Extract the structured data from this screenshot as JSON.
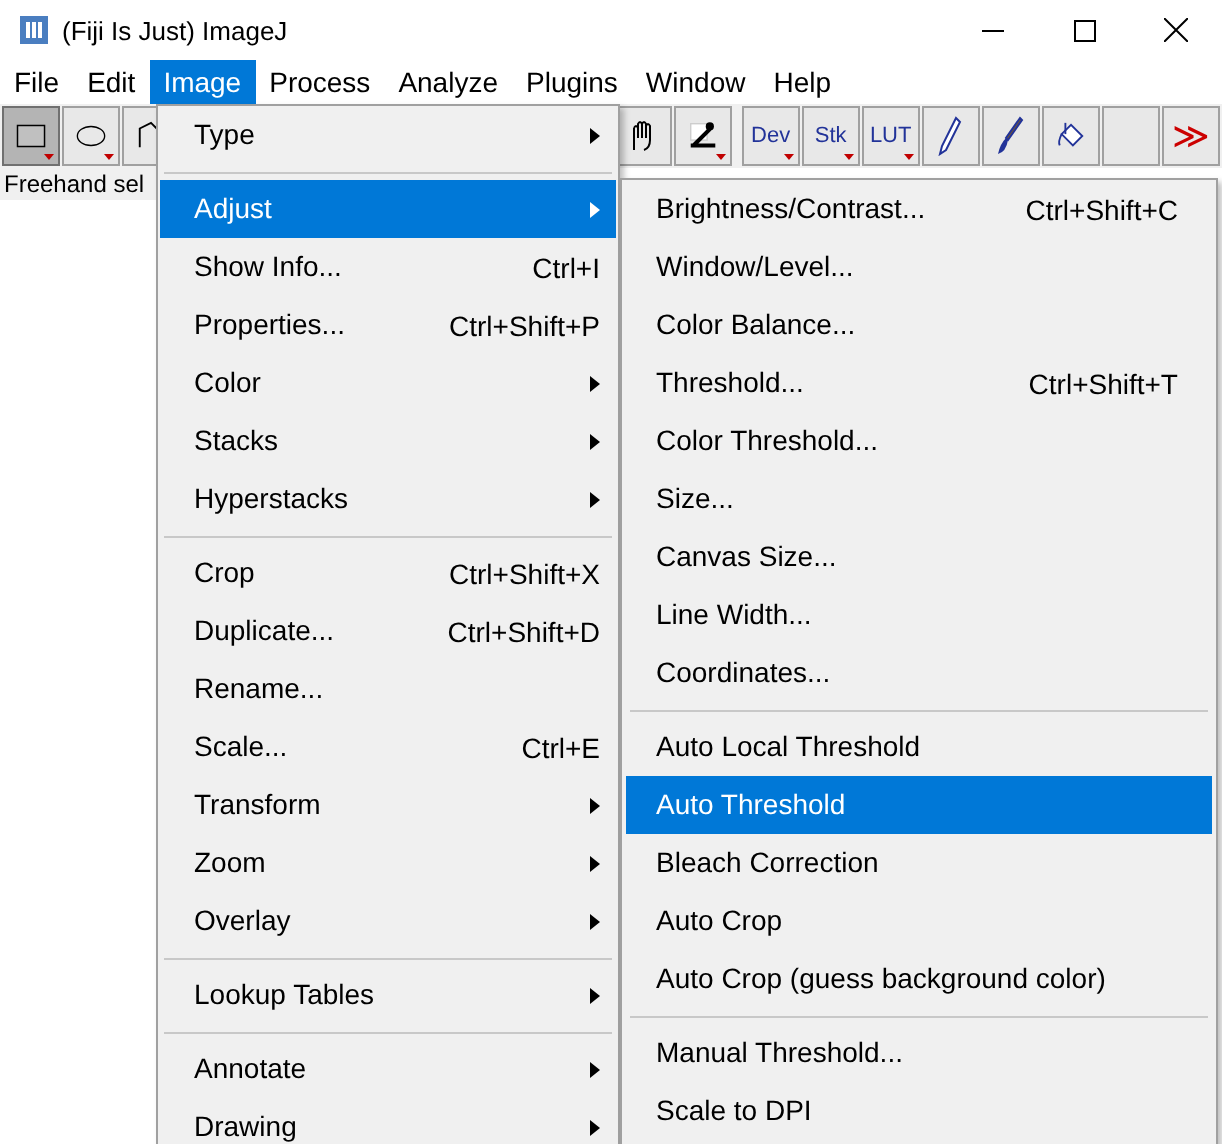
{
  "window": {
    "title": "(Fiji Is Just) ImageJ"
  },
  "menubar": [
    {
      "label": "File",
      "selected": false
    },
    {
      "label": "Edit",
      "selected": false
    },
    {
      "label": "Image",
      "selected": true
    },
    {
      "label": "Process",
      "selected": false
    },
    {
      "label": "Analyze",
      "selected": false
    },
    {
      "label": "Plugins",
      "selected": false
    },
    {
      "label": "Window",
      "selected": false
    },
    {
      "label": "Help",
      "selected": false
    }
  ],
  "toolbar_left": [
    {
      "kind": "rectangle",
      "pressed": true
    },
    {
      "kind": "oval",
      "pressed": false
    },
    {
      "kind": "polygon",
      "pressed": false
    }
  ],
  "toolbar_right": [
    {
      "kind": "hand",
      "pressed": false
    },
    {
      "kind": "angle",
      "pressed": false
    },
    {
      "kind": "gap"
    },
    {
      "kind": "text",
      "label": "Dev",
      "pressed": false
    },
    {
      "kind": "text",
      "label": "Stk",
      "pressed": false
    },
    {
      "kind": "text",
      "label": "LUT",
      "pressed": false
    },
    {
      "kind": "pencil",
      "pressed": false
    },
    {
      "kind": "brush",
      "pressed": false
    },
    {
      "kind": "fill",
      "pressed": false
    },
    {
      "kind": "blank",
      "pressed": false
    },
    {
      "kind": "more",
      "label": "≫",
      "pressed": false
    }
  ],
  "status_bar": {
    "text": "Freehand sel"
  },
  "image_menu": [
    {
      "kind": "item",
      "label": "Type",
      "submenu": true,
      "selected": false
    },
    {
      "kind": "separator"
    },
    {
      "kind": "item",
      "label": "Adjust",
      "submenu": true,
      "selected": true
    },
    {
      "kind": "item",
      "label": "Show Info...",
      "shortcut": "Ctrl+I",
      "selected": false
    },
    {
      "kind": "item",
      "label": "Properties...",
      "shortcut": "Ctrl+Shift+P",
      "selected": false
    },
    {
      "kind": "item",
      "label": "Color",
      "submenu": true,
      "selected": false
    },
    {
      "kind": "item",
      "label": "Stacks",
      "submenu": true,
      "selected": false
    },
    {
      "kind": "item",
      "label": "Hyperstacks",
      "submenu": true,
      "selected": false
    },
    {
      "kind": "separator"
    },
    {
      "kind": "item",
      "label": "Crop",
      "shortcut": "Ctrl+Shift+X",
      "selected": false
    },
    {
      "kind": "item",
      "label": "Duplicate...",
      "shortcut": "Ctrl+Shift+D",
      "selected": false
    },
    {
      "kind": "item",
      "label": "Rename...",
      "selected": false
    },
    {
      "kind": "item",
      "label": "Scale...",
      "shortcut": "Ctrl+E",
      "selected": false
    },
    {
      "kind": "item",
      "label": "Transform",
      "submenu": true,
      "selected": false
    },
    {
      "kind": "item",
      "label": "Zoom",
      "submenu": true,
      "selected": false
    },
    {
      "kind": "item",
      "label": "Overlay",
      "submenu": true,
      "selected": false
    },
    {
      "kind": "separator"
    },
    {
      "kind": "item",
      "label": "Lookup Tables",
      "submenu": true,
      "selected": false
    },
    {
      "kind": "separator"
    },
    {
      "kind": "item",
      "label": "Annotate",
      "submenu": true,
      "selected": false
    },
    {
      "kind": "item",
      "label": "Drawing",
      "submenu": true,
      "selected": false
    }
  ],
  "adjust_submenu": [
    {
      "kind": "item",
      "label": "Brightness/Contrast...",
      "shortcut": "Ctrl+Shift+C",
      "selected": false
    },
    {
      "kind": "item",
      "label": "Window/Level...",
      "selected": false
    },
    {
      "kind": "item",
      "label": "Color Balance...",
      "selected": false
    },
    {
      "kind": "item",
      "label": "Threshold...",
      "shortcut": "Ctrl+Shift+T",
      "selected": false
    },
    {
      "kind": "item",
      "label": "Color Threshold...",
      "selected": false
    },
    {
      "kind": "item",
      "label": "Size...",
      "selected": false
    },
    {
      "kind": "item",
      "label": "Canvas Size...",
      "selected": false
    },
    {
      "kind": "item",
      "label": "Line Width...",
      "selected": false
    },
    {
      "kind": "item",
      "label": "Coordinates...",
      "selected": false
    },
    {
      "kind": "separator"
    },
    {
      "kind": "item",
      "label": "Auto Local Threshold",
      "selected": false
    },
    {
      "kind": "item",
      "label": "Auto Threshold",
      "selected": true
    },
    {
      "kind": "item",
      "label": "Bleach Correction",
      "selected": false
    },
    {
      "kind": "item",
      "label": "Auto Crop",
      "selected": false
    },
    {
      "kind": "item",
      "label": "Auto Crop (guess background color)",
      "selected": false
    },
    {
      "kind": "separator"
    },
    {
      "kind": "item",
      "label": "Manual Threshold...",
      "selected": false
    },
    {
      "kind": "item",
      "label": "Scale to DPI",
      "selected": false
    }
  ]
}
